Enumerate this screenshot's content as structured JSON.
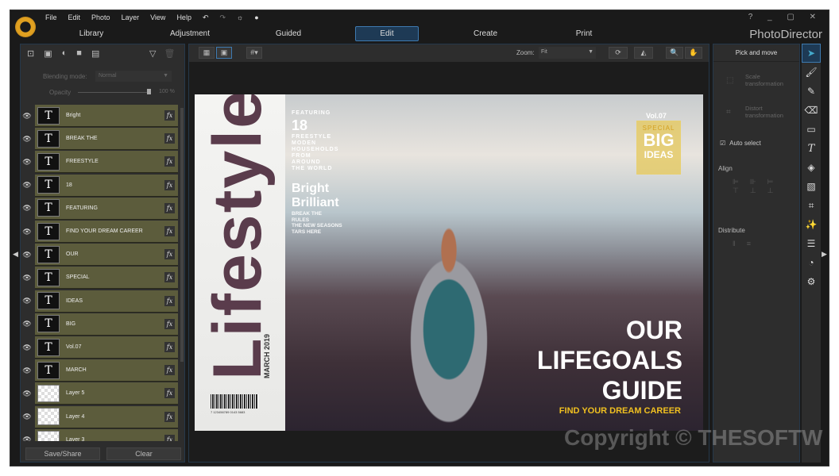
{
  "menu": [
    "File",
    "Edit",
    "Photo",
    "Layer",
    "View",
    "Help"
  ],
  "tabs": [
    "Library",
    "Adjustment",
    "Guided",
    "Edit",
    "Create",
    "Print"
  ],
  "active_tab": "Edit",
  "brand": "PhotoDirector",
  "window_controls": "? _ ▢ ✕",
  "layers_panel": {
    "blending_label": "Blending mode:",
    "blending_value": "Normal",
    "opacity_label": "Opacity",
    "opacity_value": "100 %",
    "opacity": 100,
    "layers": [
      {
        "name": "Bright",
        "type": "text"
      },
      {
        "name": "BREAK THE",
        "type": "text"
      },
      {
        "name": "FREESTYLE",
        "type": "text"
      },
      {
        "name": "18",
        "type": "text"
      },
      {
        "name": "FEATURING",
        "type": "text"
      },
      {
        "name": "FIND YOUR DREAM CAREER",
        "type": "text"
      },
      {
        "name": "OUR",
        "type": "text"
      },
      {
        "name": "SPECIAL",
        "type": "text"
      },
      {
        "name": "IDEAS",
        "type": "text"
      },
      {
        "name": "BIG",
        "type": "text"
      },
      {
        "name": "Vol.07",
        "type": "text"
      },
      {
        "name": "MARCH",
        "type": "text"
      },
      {
        "name": "Layer 5",
        "type": "image"
      },
      {
        "name": "Layer 4",
        "type": "image"
      },
      {
        "name": "Layer 3",
        "type": "image"
      }
    ],
    "save_label": "Save/Share",
    "clear_label": "Clear"
  },
  "canvas": {
    "zoom_label": "Zoom:",
    "zoom_value": "Fit"
  },
  "magazine": {
    "title": "Lifestyle",
    "date": "MARCH 2019",
    "featuring": "FEATURING",
    "num": "18",
    "feature_lines": [
      "FREESTYLE",
      "MODEN",
      "HOUSEHOLDS",
      "FROM",
      "AROUND",
      "THE WORLD"
    ],
    "bright": "Bright",
    "brilliant": "Brilliant",
    "sub_lines": [
      "BREAK THE",
      "RULES",
      "THE NEW SEASONS",
      "TARS HERE"
    ],
    "vol": "Vol.07",
    "special": "SPECIAL",
    "big": "BIG",
    "ideas": "IDEAS",
    "headline": [
      "OUR",
      "LIFEGOALS",
      "GUIDE"
    ],
    "career": "FIND YOUR DREAM CAREER",
    "barcode_num": "7 123456789 0143 5683"
  },
  "right_panel": {
    "title": "Pick and move",
    "scale": "Scale transformation",
    "distort": "Distort transformation",
    "auto_select": "Auto select",
    "auto_select_checked": true,
    "align": "Align",
    "distribute": "Distribute"
  },
  "watermark": "Copyright © THESOFTW",
  "accent": "#3e7ab0",
  "layer_color": "#5c5c3c"
}
